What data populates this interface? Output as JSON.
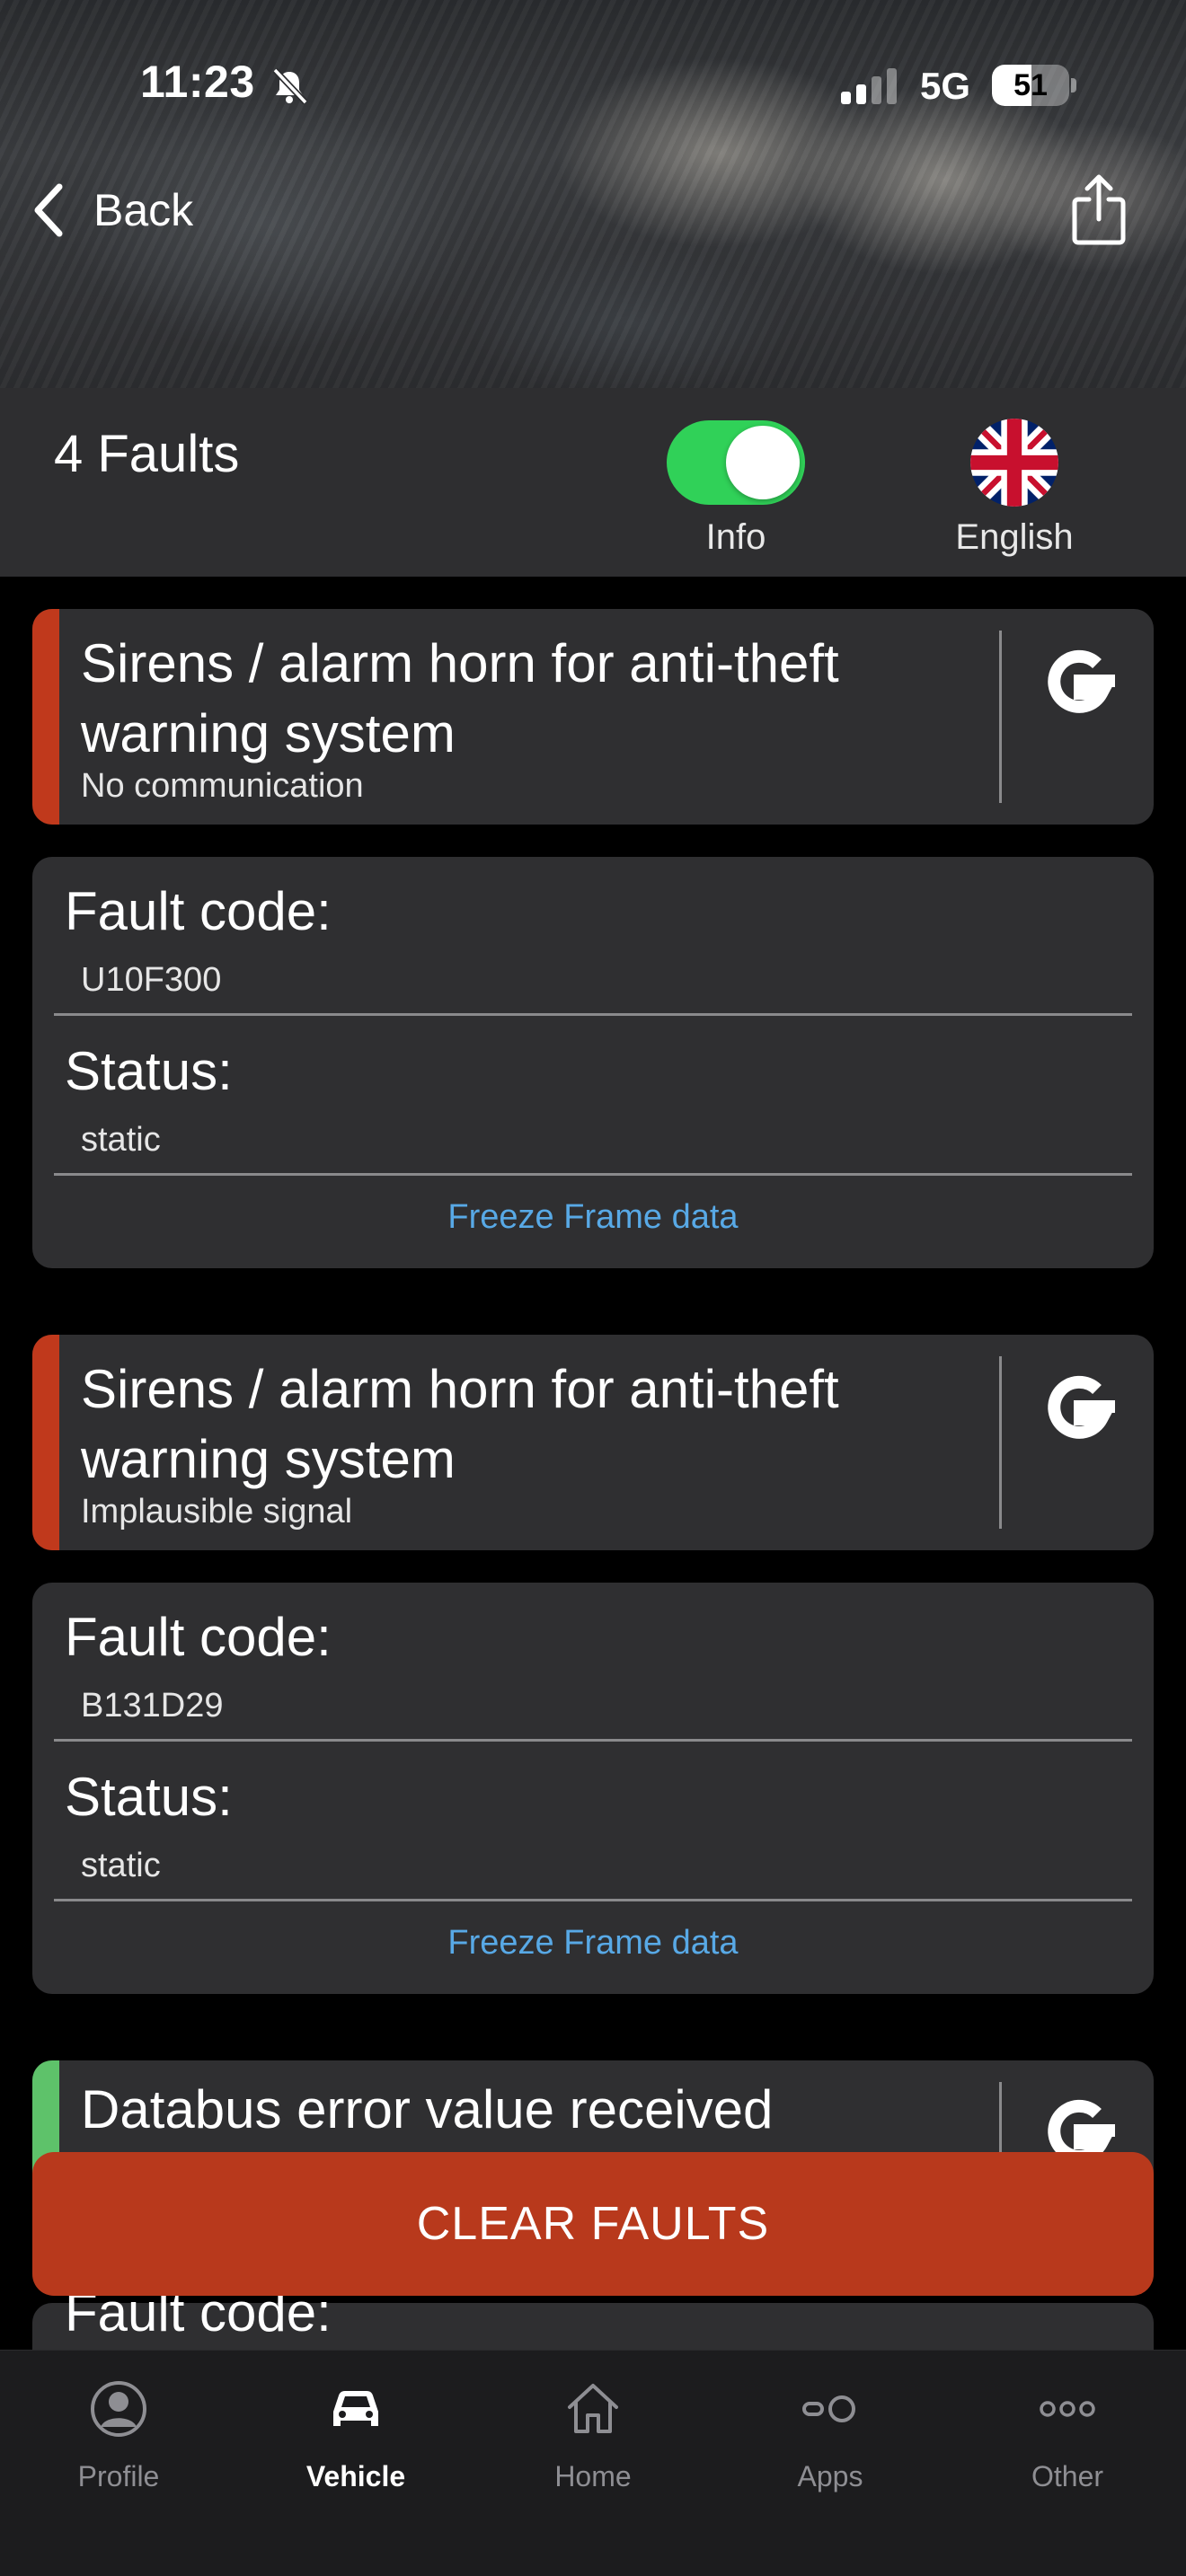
{
  "status_bar": {
    "time": "11:23",
    "network": "5G",
    "battery": "51",
    "battery_level": 0.51
  },
  "nav": {
    "back_label": "Back"
  },
  "faults_header": {
    "count_label": "4 Faults",
    "info_toggle_on": true,
    "info_label": "Info",
    "language_label": "English"
  },
  "faults": [
    {
      "title": "Sirens / alarm horn for anti-theft warning system",
      "subtitle": "No communication",
      "severity_color": "#c0391c",
      "fault_code_label": "Fault code:",
      "fault_code": "U10F300",
      "status_label": "Status:",
      "status": "static",
      "freeze_frame_label": "Freeze Frame data"
    },
    {
      "title": "Sirens / alarm horn for anti-theft warning system",
      "subtitle": "Implausible signal",
      "severity_color": "#c0391c",
      "fault_code_label": "Fault code:",
      "fault_code": "B131D29",
      "status_label": "Status:",
      "status": "static",
      "freeze_frame_label": "Freeze Frame data"
    },
    {
      "title": "Databus error value received",
      "severity_color": "#5ec26a",
      "fault_code_label": "Fault code:"
    }
  ],
  "clear_button_label": "CLEAR FAULTS",
  "tabbar": {
    "items": [
      {
        "label": "Profile",
        "icon": "profile-icon",
        "active": false
      },
      {
        "label": "Vehicle",
        "icon": "car-icon",
        "active": true
      },
      {
        "label": "Home",
        "icon": "home-icon",
        "active": false
      },
      {
        "label": "Apps",
        "icon": "apps-icon",
        "active": false
      },
      {
        "label": "Other",
        "icon": "more-icon",
        "active": false
      }
    ]
  },
  "colors": {
    "accent_blue": "#58a9e6",
    "toggle_on": "#30d158",
    "clear_button": "#b8391c",
    "card_bg": "#2f2f31"
  }
}
